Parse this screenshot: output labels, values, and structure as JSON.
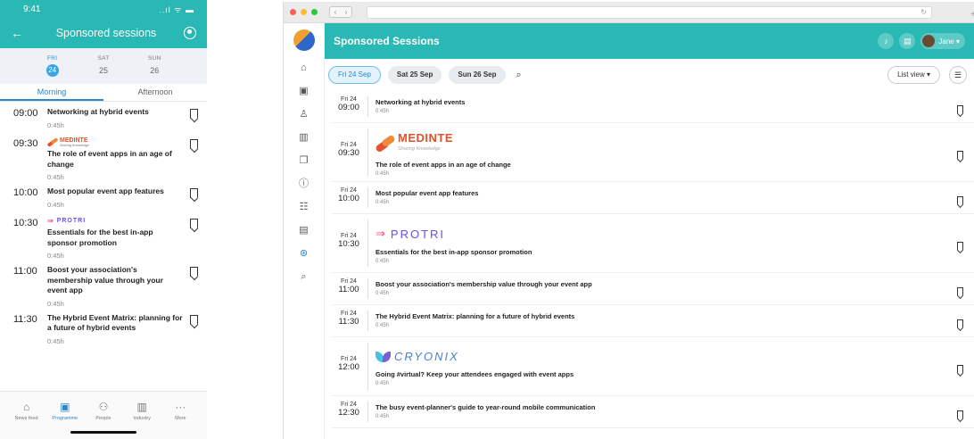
{
  "phone": {
    "status": {
      "time": "9:41",
      "icons": "..ıl ᯤ ▬"
    },
    "appbar": {
      "title": "Sponsored sessions"
    },
    "dates": [
      {
        "dow": "FRI",
        "day": "24",
        "active": true
      },
      {
        "dow": "SAT",
        "day": "25",
        "active": false
      },
      {
        "dow": "SUN",
        "day": "26",
        "active": false
      }
    ],
    "tabs": [
      "Morning",
      "Afternoon"
    ],
    "sessions": [
      {
        "time": "09:00",
        "title": "Networking at hybrid events",
        "duration": "0:45h",
        "sponsor": ""
      },
      {
        "time": "09:30",
        "title": "The role of event apps in an age of change",
        "duration": "0:45h",
        "sponsor": "medinte"
      },
      {
        "time": "10:00",
        "title": "Most popular event app features",
        "duration": "0:45h",
        "sponsor": ""
      },
      {
        "time": "10:30",
        "title": "Essentials for the best in-app sponsor promotion",
        "duration": "0:45h",
        "sponsor": "protri"
      },
      {
        "time": "11:00",
        "title": "Boost your association's membership value through your event app",
        "duration": "0:45h",
        "sponsor": ""
      },
      {
        "time": "11:30",
        "title": "The Hybrid Event Matrix: planning for a future of hybrid events",
        "duration": "0:45h",
        "sponsor": ""
      }
    ],
    "tabbar": [
      {
        "label": "News feed",
        "icon": "⌂",
        "active": false
      },
      {
        "label": "Programme",
        "icon": "▣",
        "active": true
      },
      {
        "label": "People",
        "icon": "⚇",
        "active": false
      },
      {
        "label": "Industry",
        "icon": "▥",
        "active": false
      },
      {
        "label": "More",
        "icon": "···",
        "active": false
      }
    ]
  },
  "sponsors": {
    "medinte": {
      "name": "MEDINTE",
      "tagline": "Sharing Knowledge",
      "color": "#e2532d"
    },
    "protri": {
      "name": "PROTRI",
      "color": "#6b4df0"
    },
    "cryonix": {
      "name": "CRYONIX",
      "color": "#4a7fd6"
    }
  },
  "web": {
    "title": "Sponsored Sessions",
    "user": {
      "name": "Jane"
    },
    "chips": [
      {
        "label": "Fri 24 Sep",
        "active": true
      },
      {
        "label": "Sat 25 Sep",
        "active": false
      },
      {
        "label": "Sun 26 Sep",
        "active": false
      }
    ],
    "view_select": "List view ▾",
    "sidebar_icons": [
      {
        "name": "home-icon",
        "glyph": "⌂"
      },
      {
        "name": "calendar-icon",
        "glyph": "▣"
      },
      {
        "name": "people-icon",
        "glyph": "♙"
      },
      {
        "name": "building-icon",
        "glyph": "▥"
      },
      {
        "name": "documents-icon",
        "glyph": "❐"
      },
      {
        "name": "info-icon",
        "glyph": "ⓘ"
      },
      {
        "name": "agenda-icon",
        "glyph": "☷"
      },
      {
        "name": "map-icon",
        "glyph": "▤"
      },
      {
        "name": "sponsor-icon",
        "glyph": "⊛"
      },
      {
        "name": "search-icon",
        "glyph": "⌕"
      }
    ],
    "sessions": [
      {
        "day": "Fri 24",
        "time": "09:00",
        "title": "Networking at hybrid events",
        "duration": "0:45h",
        "sponsor": ""
      },
      {
        "day": "Fri 24",
        "time": "09:30",
        "title": "The role of event apps in an age of change",
        "duration": "0:45h",
        "sponsor": "medinte"
      },
      {
        "day": "Fri 24",
        "time": "10:00",
        "title": "Most popular event app features",
        "duration": "0:45h",
        "sponsor": ""
      },
      {
        "day": "Fri 24",
        "time": "10:30",
        "title": "Essentials for the best in-app sponsor promotion",
        "duration": "0:45h",
        "sponsor": "protri"
      },
      {
        "day": "Fri 24",
        "time": "11:00",
        "title": "Boost your association's membership value through your event app",
        "duration": "0:45h",
        "sponsor": ""
      },
      {
        "day": "Fri 24",
        "time": "11:30",
        "title": "The Hybrid Event Matrix: planning for a future of hybrid events",
        "duration": "0:45h",
        "sponsor": ""
      },
      {
        "day": "Fri 24",
        "time": "12:00",
        "title": "Going #virtual? Keep your attendees engaged with event apps",
        "duration": "0:45h",
        "sponsor": "cryonix"
      },
      {
        "day": "Fri 24",
        "time": "12:30",
        "title": "The busy event-planner's guide to year-round mobile communication",
        "duration": "0:45h",
        "sponsor": ""
      }
    ]
  }
}
